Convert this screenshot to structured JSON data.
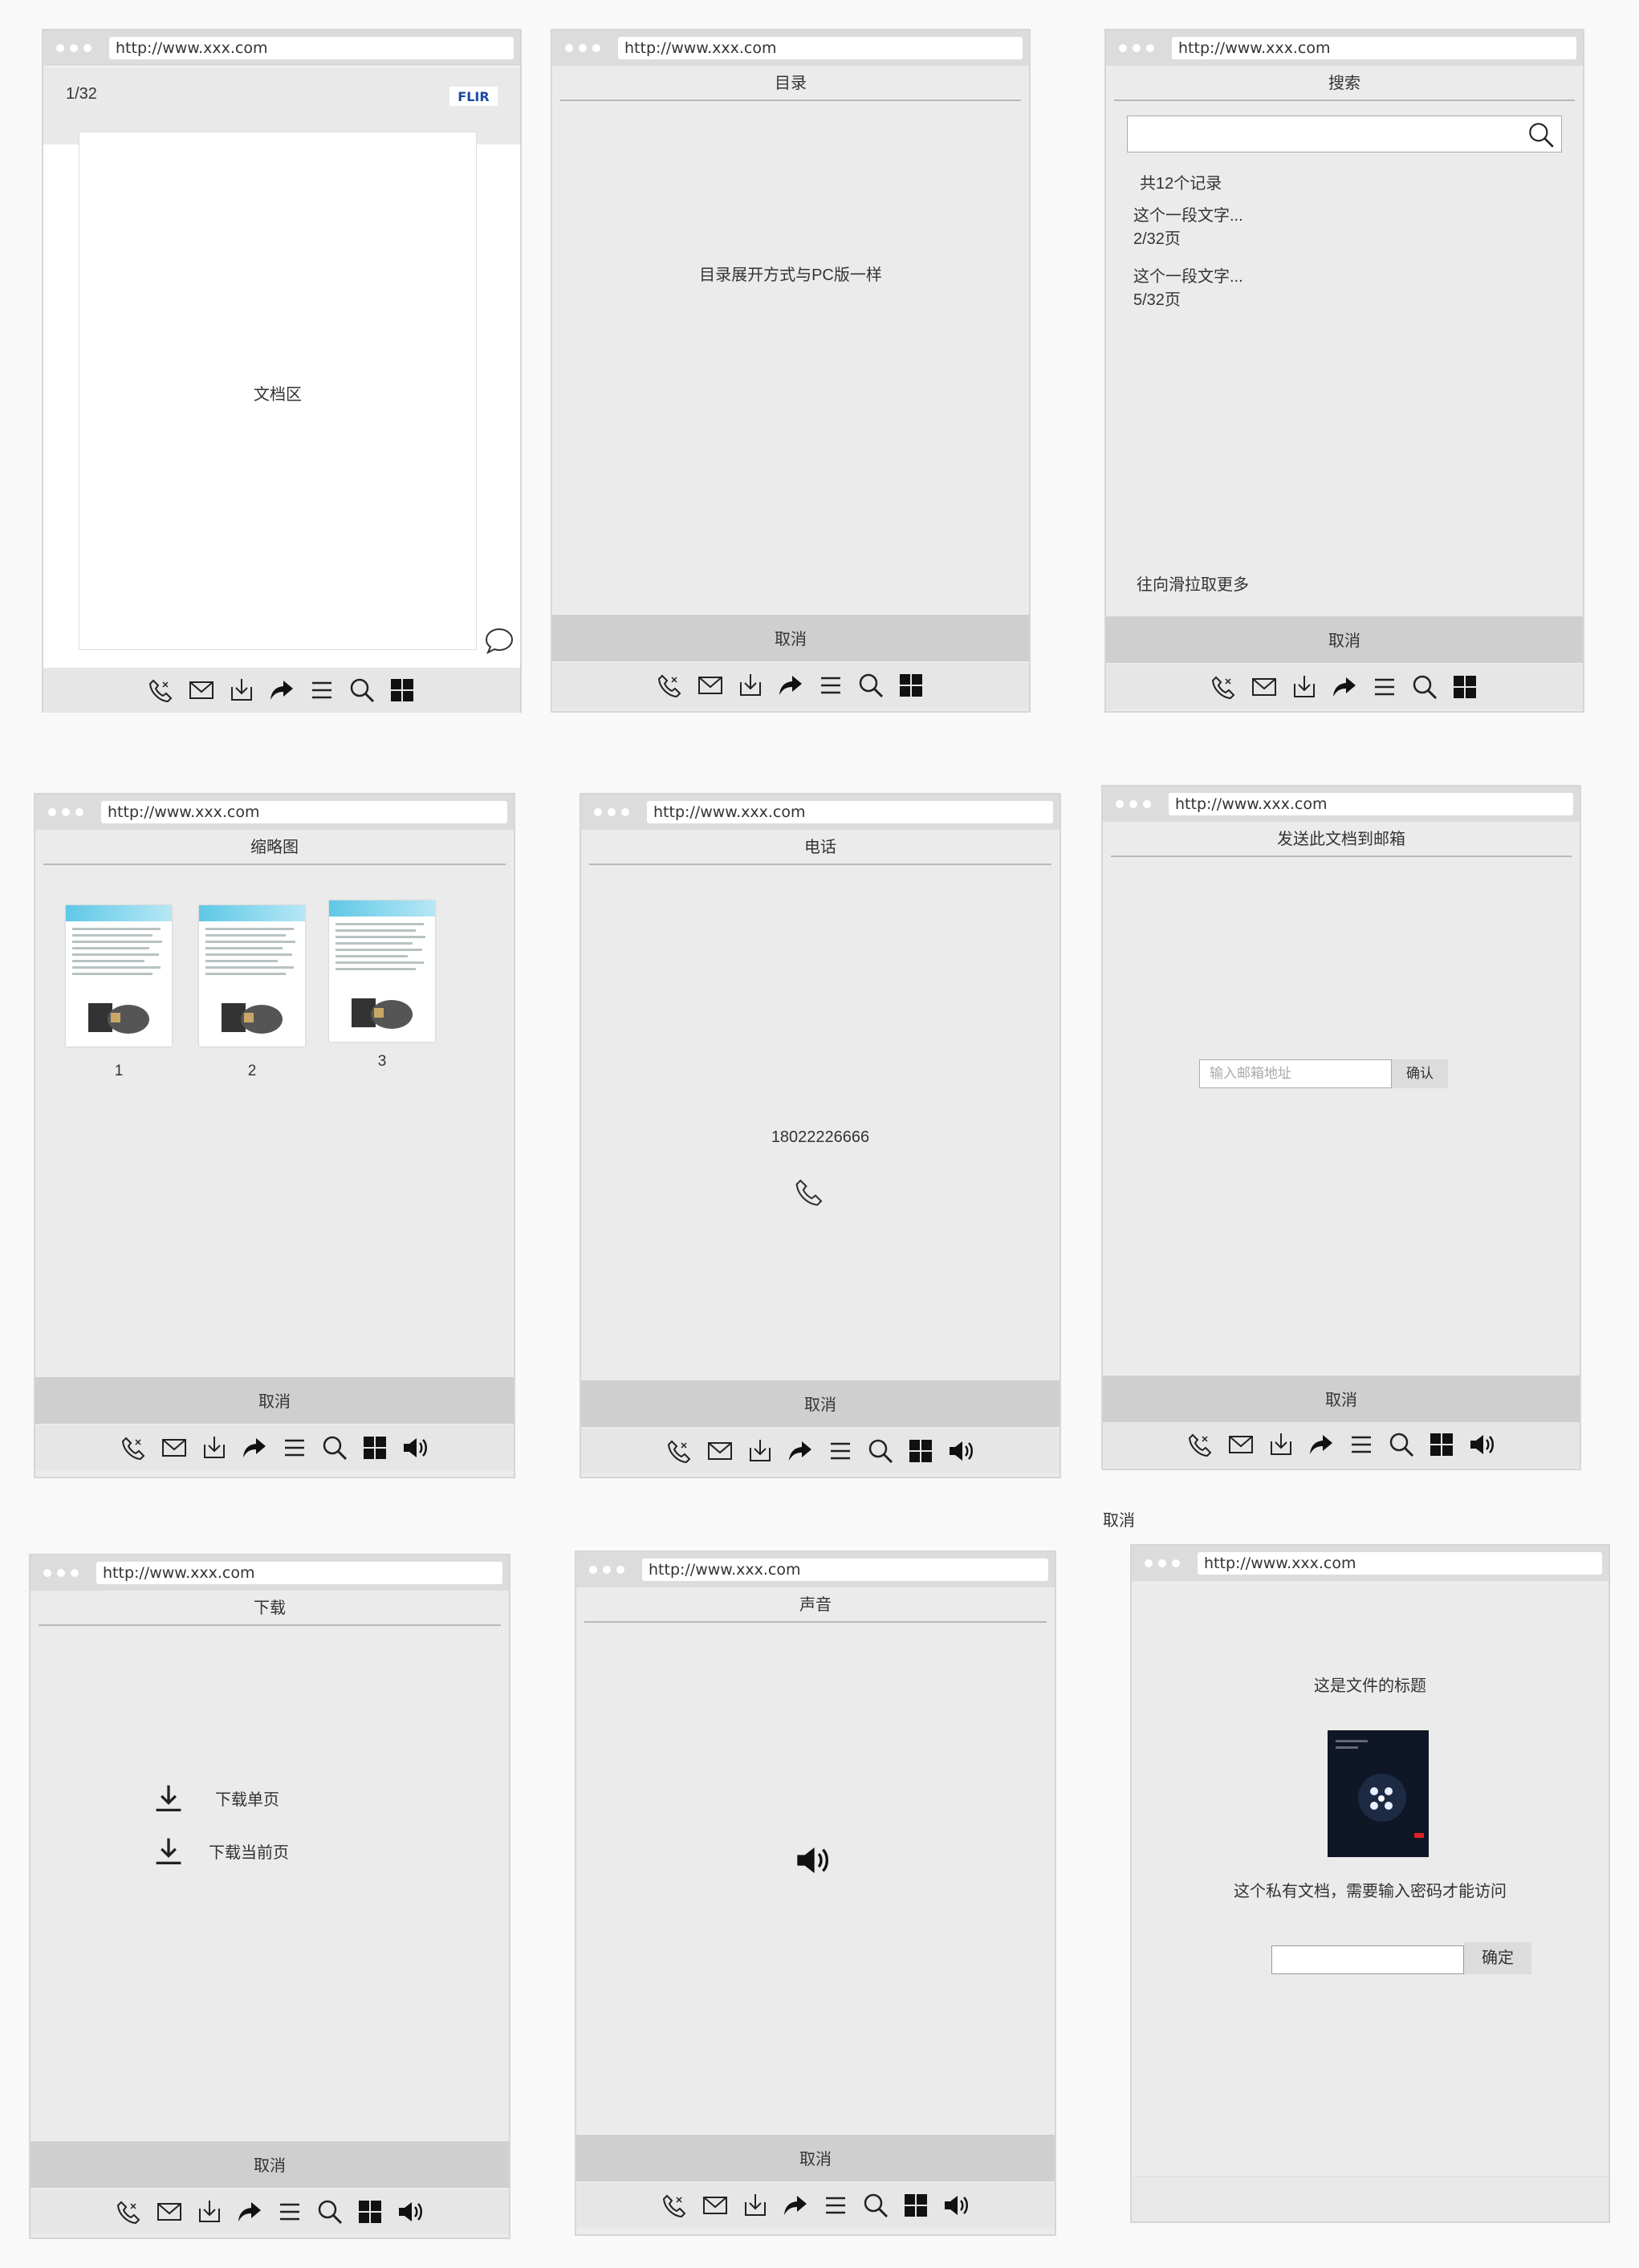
{
  "url": "http://www.xxx.com",
  "cancel_label": "取消",
  "screens": {
    "document": {
      "page_counter": "1/32",
      "brand_logo": "FLIR",
      "doc_area": "文档区",
      "comment_icon": "speech-bubble-icon"
    },
    "toc": {
      "title": "目录",
      "message": "目录展开方式与PC版一样"
    },
    "search": {
      "title": "搜索",
      "record_count": "共12个记录",
      "results": [
        {
          "snippet": "这个一段文字...",
          "page": "2/32页"
        },
        {
          "snippet": "这个一段文字...",
          "page": "5/32页"
        }
      ],
      "load_more": "往向滑拉取更多"
    },
    "thumbnails": {
      "title": "缩略图",
      "pages": [
        "1",
        "2",
        "3"
      ]
    },
    "phone": {
      "title": "电话",
      "number": "18022226666"
    },
    "email": {
      "title": "发送此文档到邮箱",
      "placeholder": "输入邮箱地址",
      "confirm": "确认"
    },
    "download": {
      "title": "下载",
      "options": [
        "下载单页",
        "下载当前页"
      ]
    },
    "sound": {
      "title": "声音"
    },
    "private": {
      "doc_title": "这是文件的标题",
      "notice": "这个私有文档，需要输入密码才能访问",
      "confirm": "确定"
    }
  },
  "stray_label": "取消",
  "toolbar_icons": [
    "phone-icon",
    "mail-icon",
    "download-icon",
    "share-icon",
    "menu-icon",
    "search-icon",
    "grid-icon",
    "sound-icon"
  ]
}
